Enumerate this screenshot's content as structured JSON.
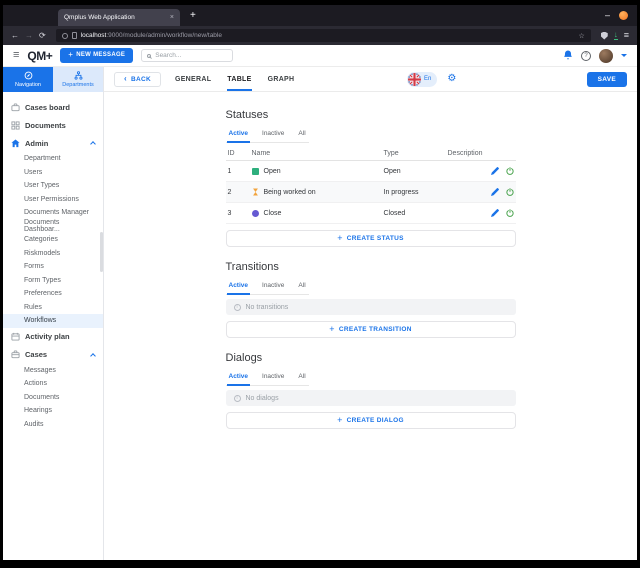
{
  "colors": {
    "accent": "#1a73e8",
    "power_green": "#43a047"
  },
  "icons": {
    "close": "×",
    "new_tab": "+",
    "minimize": "–",
    "back": "←",
    "forward": "→",
    "reload": "⟳",
    "star": "☆",
    "download": "↓",
    "menu": "≡",
    "hamburger": "≡",
    "gear": "⚙",
    "help": "?",
    "info": "i",
    "plus": "+",
    "chevron_left": "‹"
  },
  "browser": {
    "tab_title": "Qmplus Web Application",
    "url_host": "localhost",
    "url_rest": ":9000/module/admin/workflow/new/table"
  },
  "appbar": {
    "logo": "QM+",
    "new_message": "NEW MESSAGE",
    "search_placeholder": "Search..."
  },
  "sidebar": {
    "nav_tab": "Navigation",
    "dept_tab": "Departments",
    "cases_board": "Cases board",
    "documents": "Documents",
    "admin": {
      "label": "Admin",
      "children": [
        "Department",
        "Users",
        "User Types",
        "User Permissions",
        "Documents Manager",
        "Documents Dashboar...",
        "Categories",
        "Riskmodels",
        "Forms",
        "Form Types",
        "Preferences",
        "Rules",
        "Workflows"
      ]
    },
    "active_item": "Workflows",
    "activity_plan": "Activity plan",
    "cases": {
      "label": "Cases",
      "children": [
        "Messages",
        "Actions",
        "Documents",
        "Hearings",
        "Audits"
      ]
    }
  },
  "workflow_bar": {
    "back": "BACK",
    "tabs": [
      "GENERAL",
      "TABLE",
      "GRAPH"
    ],
    "active_tab": "TABLE",
    "language": "En",
    "save": "SAVE"
  },
  "statuses": {
    "title": "Statuses",
    "tabs": [
      "Active",
      "Inactive",
      "All"
    ],
    "active_tab": "Active",
    "columns": [
      "ID",
      "Name",
      "Type",
      "Description"
    ],
    "rows": [
      {
        "id": "1",
        "name": "Open",
        "type": "Open",
        "description": "",
        "color": "#2eaf7d",
        "icon": "square"
      },
      {
        "id": "2",
        "name": "Being worked on",
        "type": "In progress",
        "description": "",
        "color": "#f2a33c",
        "icon": "hourglass"
      },
      {
        "id": "3",
        "name": "Close",
        "type": "Closed",
        "description": "",
        "color": "#6559d2",
        "icon": "circle"
      }
    ],
    "create": "CREATE STATUS"
  },
  "transitions": {
    "title": "Transitions",
    "tabs": [
      "Active",
      "Inactive",
      "All"
    ],
    "active_tab": "Active",
    "empty": "No transitions",
    "create": "CREATE TRANSITION"
  },
  "dialogs": {
    "title": "Dialogs",
    "tabs": [
      "Active",
      "Inactive",
      "All"
    ],
    "active_tab": "Active",
    "empty": "No dialogs",
    "create": "CREATE DIALOG"
  }
}
